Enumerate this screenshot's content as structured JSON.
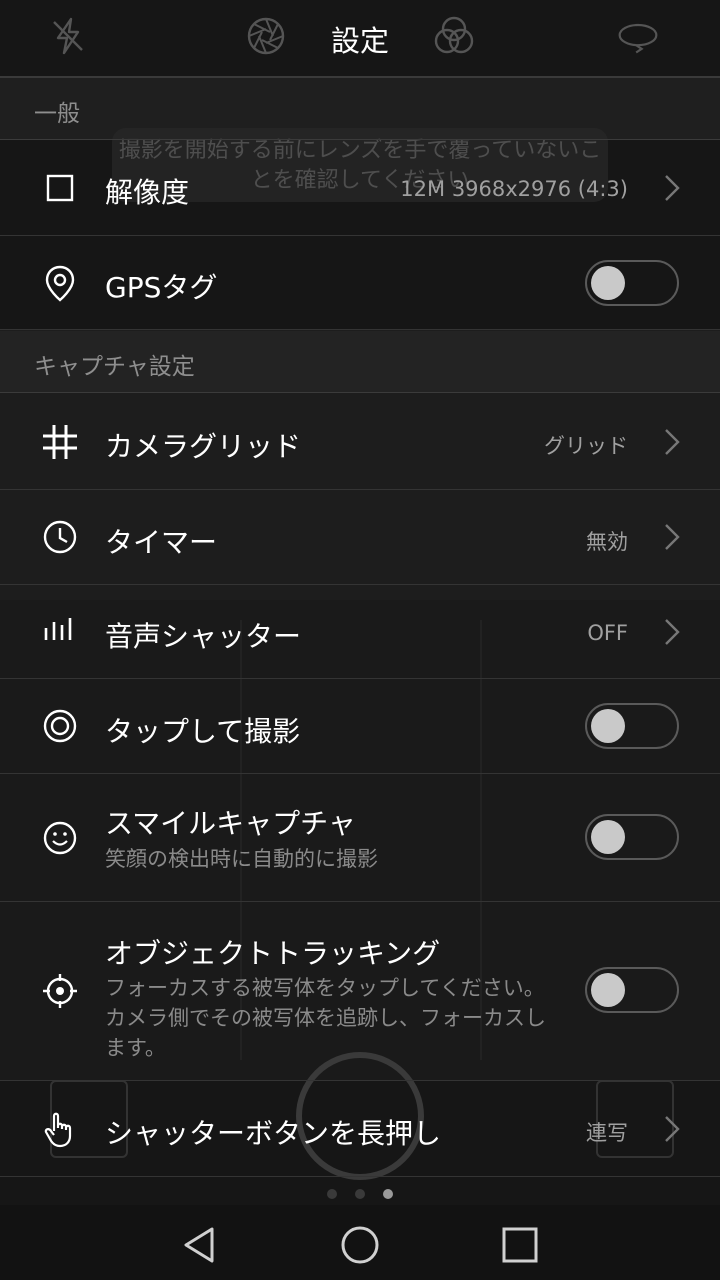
{
  "header": {
    "title": "設定",
    "icons": [
      "flash-off-icon",
      "aperture-icon",
      "color-filter-icon",
      "switch-camera-icon"
    ]
  },
  "sections": {
    "general": "一般",
    "capture": "キャプチャ設定"
  },
  "rows": {
    "resolution": {
      "label": "解像度",
      "value": "12M 3968x2976 (4:3)",
      "icon": "square-icon"
    },
    "gps": {
      "label": "GPSタグ",
      "icon": "location-pin-icon",
      "toggle": false
    },
    "grid": {
      "label": "カメラグリッド",
      "value": "グリッド",
      "icon": "grid-icon"
    },
    "timer": {
      "label": "タイマー",
      "value": "無効",
      "icon": "clock-icon"
    },
    "audio": {
      "label": "音声シャッター",
      "value": "OFF",
      "icon": "audio-level-icon"
    },
    "tap": {
      "label": "タップして撮影",
      "icon": "target-icon",
      "toggle": false
    },
    "smile": {
      "label": "スマイルキャプチャ",
      "sub": "笑顔の検出時に自動的に撮影",
      "icon": "smile-icon",
      "toggle": false
    },
    "tracking": {
      "label": "オブジェクトトラッキング",
      "sub": "フォーカスする被写体をタップしてください。カメラ側でその被写体を追跡し、フォーカスします。",
      "icon": "crosshair-icon",
      "toggle": false
    },
    "longpress": {
      "label": "シャッターボタンを長押し",
      "value": "連写",
      "icon": "hand-touch-icon"
    }
  },
  "background_hint": "撮影を開始する前にレンズを手で覆っていないことを確認してください",
  "page_dots": {
    "count": 3,
    "active": 3
  },
  "navbar": {
    "buttons": [
      "back-icon",
      "home-icon",
      "recents-icon"
    ]
  },
  "colors": {
    "background": "#161616",
    "text": "#ffffff",
    "secondary": "#8e8e8e",
    "toggle_knob": "#c9c9c9"
  }
}
